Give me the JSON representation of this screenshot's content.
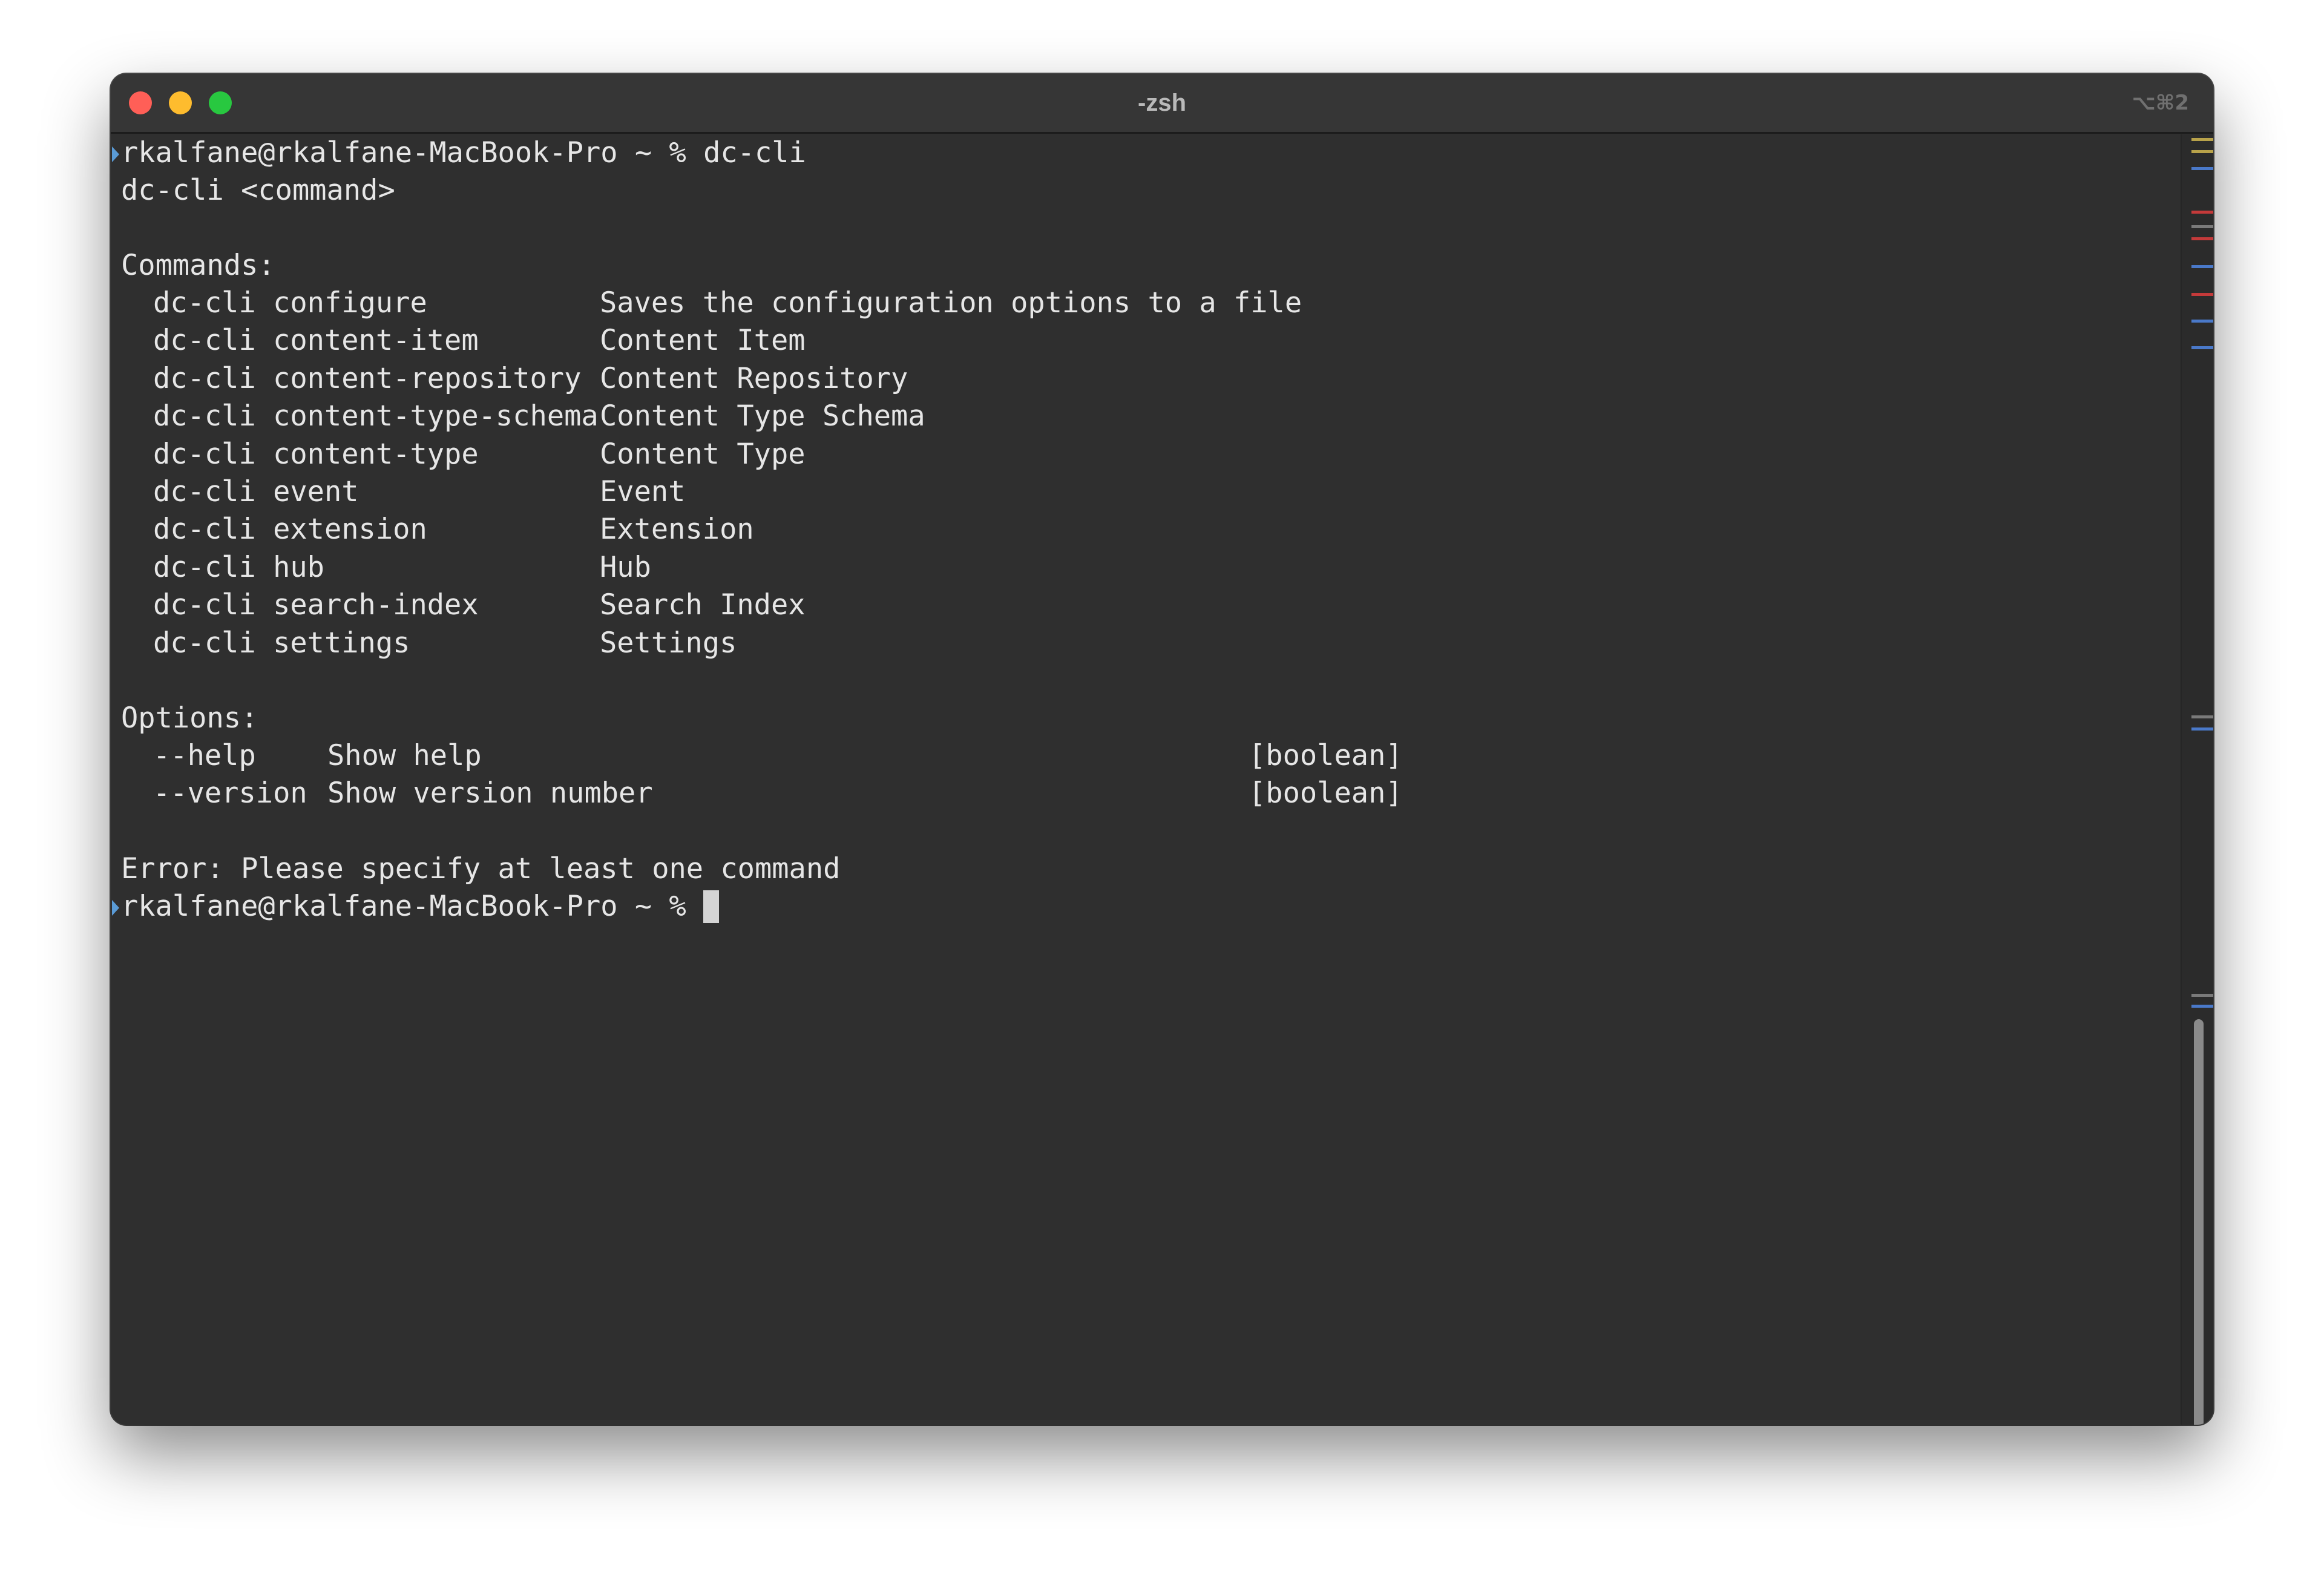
{
  "window": {
    "title": "-zsh",
    "shortcut": "⌥⌘2"
  },
  "terminal": {
    "prompt_line": "rkalfane@rkalfane-MacBook-Pro ~ % dc-cli",
    "usage_line": "dc-cli <command>",
    "commands_header": "Commands:",
    "commands": [
      {
        "cmd": "dc-cli configure",
        "desc": "Saves the configuration options to a file"
      },
      {
        "cmd": "dc-cli content-item",
        "desc": "Content Item"
      },
      {
        "cmd": "dc-cli content-repository",
        "desc": "Content Repository"
      },
      {
        "cmd": "dc-cli content-type-schema",
        "desc": "Content Type Schema"
      },
      {
        "cmd": "dc-cli content-type",
        "desc": "Content Type"
      },
      {
        "cmd": "dc-cli event",
        "desc": "Event"
      },
      {
        "cmd": "dc-cli extension",
        "desc": "Extension"
      },
      {
        "cmd": "dc-cli hub",
        "desc": "Hub"
      },
      {
        "cmd": "dc-cli search-index",
        "desc": "Search Index"
      },
      {
        "cmd": "dc-cli settings",
        "desc": "Settings"
      }
    ],
    "options_header": "Options:",
    "options": [
      {
        "flag": "--help",
        "desc": "Show help",
        "type": "[boolean]"
      },
      {
        "flag": "--version",
        "desc": "Show version number",
        "type": "[boolean]"
      }
    ],
    "error_line": "Error: Please specify at least one command",
    "current_prompt": "rkalfane@rkalfane-MacBook-Pro ~ % "
  },
  "colors": {
    "background": "#2f2f2f",
    "text": "#e6e6e6",
    "mark": "#5a9bd6",
    "scroll_ticks": [
      "#b8a24a",
      "#b8a24a",
      "#4a79c9",
      "#c43a3a",
      "#7a7a7a",
      "#c43a3a",
      "#4a79c9",
      "#c43a3a",
      "#4a79c9",
      "#4a79c9",
      "#7a7a7a",
      "#4a79c9",
      "#7a7a7a",
      "#4a79c9"
    ]
  }
}
